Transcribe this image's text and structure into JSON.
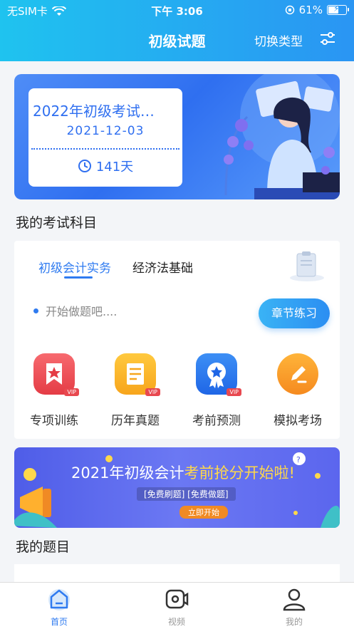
{
  "status_bar": {
    "carrier": "无SIM卡",
    "time": "下午 3:06",
    "battery": "61%",
    "battery_level": 0.61
  },
  "header": {
    "title": "初级试题",
    "switch_label": "切换类型"
  },
  "exam_banner": {
    "title": "2022年初级考试…",
    "date": "2021-12-03",
    "days_left": "141天"
  },
  "subjects": {
    "section_title": "我的考试科目",
    "tabs": [
      {
        "label": "初级会计实务",
        "active": true
      },
      {
        "label": "经济法基础",
        "active": false
      }
    ],
    "start_text": "开始做题吧....",
    "practice_button": "章节练习",
    "features": [
      {
        "label": "专项训练",
        "icon": "bookmark-star-icon",
        "badge": "VIP",
        "color": "#f04b52"
      },
      {
        "label": "历年真题",
        "icon": "document-icon",
        "badge": "VIP",
        "color": "#fbb21c"
      },
      {
        "label": "考前预测",
        "icon": "medal-icon",
        "badge": "VIP",
        "color": "#2f7bf0"
      },
      {
        "label": "模拟考场",
        "icon": "edit-icon",
        "badge": "",
        "color": "#f7a21c"
      }
    ]
  },
  "promo": {
    "title_normal": "2021年初级会计",
    "title_highlight": "考前抢分开始啦!",
    "subtitle": "[免费刷题] [免费做题]",
    "button": "立即开始"
  },
  "my_questions": {
    "section_title": "我的题目"
  },
  "tabbar": [
    {
      "label": "首页",
      "icon": "home-icon",
      "active": true
    },
    {
      "label": "视频",
      "icon": "video-icon",
      "active": false
    },
    {
      "label": "我的",
      "icon": "profile-icon",
      "active": false
    }
  ]
}
